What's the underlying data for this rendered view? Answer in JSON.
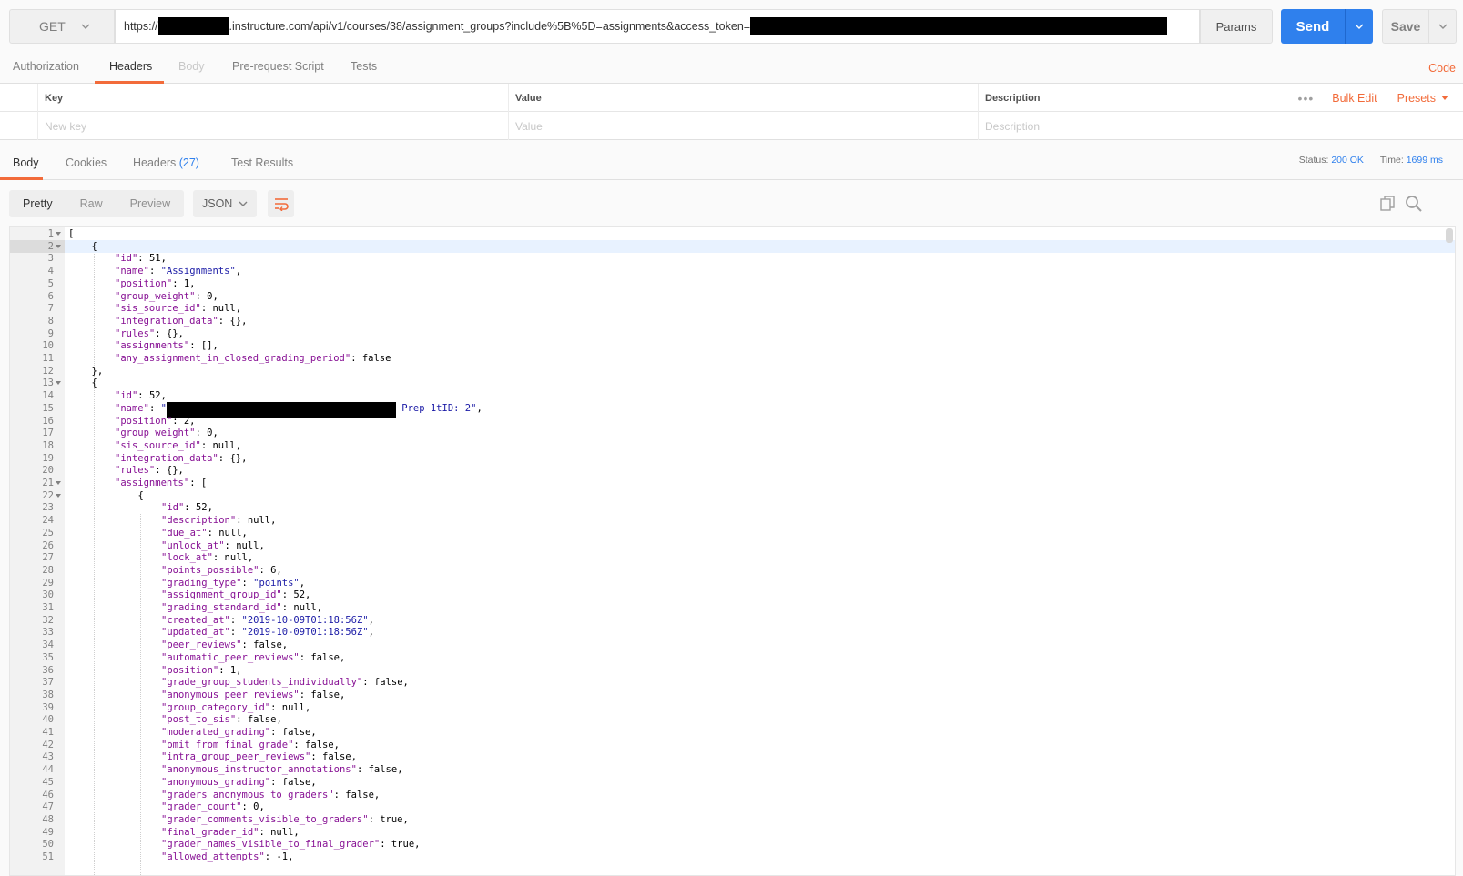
{
  "request": {
    "method": "GET",
    "url_prefix": "https://",
    "url_middle": ".instructure.com/api/v1/courses/38/assignment_groups?include%5B%5D=assignments&access_token=",
    "params_label": "Params",
    "send_label": "Send",
    "save_label": "Save"
  },
  "request_tabs": {
    "authorization": "Authorization",
    "headers": "Headers",
    "body": "Body",
    "prerequest": "Pre-request Script",
    "tests": "Tests",
    "code": "Code"
  },
  "headers_table": {
    "col_key": "Key",
    "col_value": "Value",
    "col_description": "Description",
    "bulk_edit": "Bulk Edit",
    "presets": "Presets",
    "placeholder_key": "New key",
    "placeholder_value": "Value",
    "placeholder_description": "Description"
  },
  "response_tabs": {
    "body": "Body",
    "cookies": "Cookies",
    "headers": "Headers",
    "headers_count": "(27)",
    "test_results": "Test Results",
    "status_label": "Status:",
    "status_value": "200 OK",
    "time_label": "Time:",
    "time_value": "1699 ms"
  },
  "response_toolbar": {
    "pretty": "Pretty",
    "raw": "Raw",
    "preview": "Preview",
    "format": "JSON"
  },
  "colors": {
    "accent": "#f26b3a",
    "send_blue": "#2f80ed",
    "key_purple": "#871094",
    "string_blue": "#1a1aa6"
  },
  "code_lines": [
    {
      "n": "1",
      "fold": true,
      "indent": 0,
      "tokens": [
        [
          "p",
          "["
        ]
      ]
    },
    {
      "n": "2",
      "fold": true,
      "indent": 1,
      "tokens": [
        [
          "p",
          "{"
        ]
      ],
      "active": true
    },
    {
      "n": "3",
      "indent": 2,
      "tokens": [
        [
          "k",
          "\"id\""
        ],
        [
          "p",
          ": 51,"
        ]
      ]
    },
    {
      "n": "4",
      "indent": 2,
      "tokens": [
        [
          "k",
          "\"name\""
        ],
        [
          "p",
          ": "
        ],
        [
          "s",
          "\"Assignments\""
        ],
        [
          "p",
          ","
        ]
      ]
    },
    {
      "n": "5",
      "indent": 2,
      "tokens": [
        [
          "k",
          "\"position\""
        ],
        [
          "p",
          ": 1,"
        ]
      ]
    },
    {
      "n": "6",
      "indent": 2,
      "tokens": [
        [
          "k",
          "\"group_weight\""
        ],
        [
          "p",
          ": 0,"
        ]
      ]
    },
    {
      "n": "7",
      "indent": 2,
      "tokens": [
        [
          "k",
          "\"sis_source_id\""
        ],
        [
          "p",
          ": null,"
        ]
      ]
    },
    {
      "n": "8",
      "indent": 2,
      "tokens": [
        [
          "k",
          "\"integration_data\""
        ],
        [
          "p",
          ": {},"
        ]
      ]
    },
    {
      "n": "9",
      "indent": 2,
      "tokens": [
        [
          "k",
          "\"rules\""
        ],
        [
          "p",
          ": {},"
        ]
      ]
    },
    {
      "n": "10",
      "indent": 2,
      "tokens": [
        [
          "k",
          "\"assignments\""
        ],
        [
          "p",
          ": [],"
        ]
      ]
    },
    {
      "n": "11",
      "indent": 2,
      "tokens": [
        [
          "k",
          "\"any_assignment_in_closed_grading_period\""
        ],
        [
          "p",
          ": false"
        ]
      ]
    },
    {
      "n": "12",
      "indent": 1,
      "tokens": [
        [
          "p",
          "},"
        ]
      ]
    },
    {
      "n": "13",
      "fold": true,
      "indent": 1,
      "tokens": [
        [
          "p",
          "{"
        ]
      ]
    },
    {
      "n": "14",
      "indent": 2,
      "tokens": [
        [
          "k",
          "\"id\""
        ],
        [
          "p",
          ": 52,"
        ]
      ]
    },
    {
      "n": "15",
      "indent": 2,
      "tokens": [
        [
          "k",
          "\"name\""
        ],
        [
          "p",
          ": "
        ],
        [
          "s",
          "\""
        ],
        [
          "r",
          ""
        ],
        [
          "s",
          " Prep 1tID: 2\""
        ],
        [
          "p",
          ","
        ]
      ]
    },
    {
      "n": "16",
      "indent": 2,
      "tokens": [
        [
          "k",
          "\"position\""
        ],
        [
          "p",
          ": 2,"
        ]
      ]
    },
    {
      "n": "17",
      "indent": 2,
      "tokens": [
        [
          "k",
          "\"group_weight\""
        ],
        [
          "p",
          ": 0,"
        ]
      ]
    },
    {
      "n": "18",
      "indent": 2,
      "tokens": [
        [
          "k",
          "\"sis_source_id\""
        ],
        [
          "p",
          ": null,"
        ]
      ]
    },
    {
      "n": "19",
      "indent": 2,
      "tokens": [
        [
          "k",
          "\"integration_data\""
        ],
        [
          "p",
          ": {},"
        ]
      ]
    },
    {
      "n": "20",
      "indent": 2,
      "tokens": [
        [
          "k",
          "\"rules\""
        ],
        [
          "p",
          ": {},"
        ]
      ]
    },
    {
      "n": "21",
      "fold": true,
      "indent": 2,
      "tokens": [
        [
          "k",
          "\"assignments\""
        ],
        [
          "p",
          ": ["
        ]
      ]
    },
    {
      "n": "22",
      "fold": true,
      "indent": 3,
      "tokens": [
        [
          "p",
          "{"
        ]
      ]
    },
    {
      "n": "23",
      "indent": 4,
      "tokens": [
        [
          "k",
          "\"id\""
        ],
        [
          "p",
          ": 52,"
        ]
      ]
    },
    {
      "n": "24",
      "indent": 4,
      "tokens": [
        [
          "k",
          "\"description\""
        ],
        [
          "p",
          ": null,"
        ]
      ]
    },
    {
      "n": "25",
      "indent": 4,
      "tokens": [
        [
          "k",
          "\"due_at\""
        ],
        [
          "p",
          ": null,"
        ]
      ]
    },
    {
      "n": "26",
      "indent": 4,
      "tokens": [
        [
          "k",
          "\"unlock_at\""
        ],
        [
          "p",
          ": null,"
        ]
      ]
    },
    {
      "n": "27",
      "indent": 4,
      "tokens": [
        [
          "k",
          "\"lock_at\""
        ],
        [
          "p",
          ": null,"
        ]
      ]
    },
    {
      "n": "28",
      "indent": 4,
      "tokens": [
        [
          "k",
          "\"points_possible\""
        ],
        [
          "p",
          ": 6,"
        ]
      ]
    },
    {
      "n": "29",
      "indent": 4,
      "tokens": [
        [
          "k",
          "\"grading_type\""
        ],
        [
          "p",
          ": "
        ],
        [
          "s",
          "\"points\""
        ],
        [
          "p",
          ","
        ]
      ]
    },
    {
      "n": "30",
      "indent": 4,
      "tokens": [
        [
          "k",
          "\"assignment_group_id\""
        ],
        [
          "p",
          ": 52,"
        ]
      ]
    },
    {
      "n": "31",
      "indent": 4,
      "tokens": [
        [
          "k",
          "\"grading_standard_id\""
        ],
        [
          "p",
          ": null,"
        ]
      ]
    },
    {
      "n": "32",
      "indent": 4,
      "tokens": [
        [
          "k",
          "\"created_at\""
        ],
        [
          "p",
          ": "
        ],
        [
          "s",
          "\"2019-10-09T01:18:56Z\""
        ],
        [
          "p",
          ","
        ]
      ]
    },
    {
      "n": "33",
      "indent": 4,
      "tokens": [
        [
          "k",
          "\"updated_at\""
        ],
        [
          "p",
          ": "
        ],
        [
          "s",
          "\"2019-10-09T01:18:56Z\""
        ],
        [
          "p",
          ","
        ]
      ]
    },
    {
      "n": "34",
      "indent": 4,
      "tokens": [
        [
          "k",
          "\"peer_reviews\""
        ],
        [
          "p",
          ": false,"
        ]
      ]
    },
    {
      "n": "35",
      "indent": 4,
      "tokens": [
        [
          "k",
          "\"automatic_peer_reviews\""
        ],
        [
          "p",
          ": false,"
        ]
      ]
    },
    {
      "n": "36",
      "indent": 4,
      "tokens": [
        [
          "k",
          "\"position\""
        ],
        [
          "p",
          ": 1,"
        ]
      ]
    },
    {
      "n": "37",
      "indent": 4,
      "tokens": [
        [
          "k",
          "\"grade_group_students_individually\""
        ],
        [
          "p",
          ": false,"
        ]
      ]
    },
    {
      "n": "38",
      "indent": 4,
      "tokens": [
        [
          "k",
          "\"anonymous_peer_reviews\""
        ],
        [
          "p",
          ": false,"
        ]
      ]
    },
    {
      "n": "39",
      "indent": 4,
      "tokens": [
        [
          "k",
          "\"group_category_id\""
        ],
        [
          "p",
          ": null,"
        ]
      ]
    },
    {
      "n": "40",
      "indent": 4,
      "tokens": [
        [
          "k",
          "\"post_to_sis\""
        ],
        [
          "p",
          ": false,"
        ]
      ]
    },
    {
      "n": "41",
      "indent": 4,
      "tokens": [
        [
          "k",
          "\"moderated_grading\""
        ],
        [
          "p",
          ": false,"
        ]
      ]
    },
    {
      "n": "42",
      "indent": 4,
      "tokens": [
        [
          "k",
          "\"omit_from_final_grade\""
        ],
        [
          "p",
          ": false,"
        ]
      ]
    },
    {
      "n": "43",
      "indent": 4,
      "tokens": [
        [
          "k",
          "\"intra_group_peer_reviews\""
        ],
        [
          "p",
          ": false,"
        ]
      ]
    },
    {
      "n": "44",
      "indent": 4,
      "tokens": [
        [
          "k",
          "\"anonymous_instructor_annotations\""
        ],
        [
          "p",
          ": false,"
        ]
      ]
    },
    {
      "n": "45",
      "indent": 4,
      "tokens": [
        [
          "k",
          "\"anonymous_grading\""
        ],
        [
          "p",
          ": false,"
        ]
      ]
    },
    {
      "n": "46",
      "indent": 4,
      "tokens": [
        [
          "k",
          "\"graders_anonymous_to_graders\""
        ],
        [
          "p",
          ": false,"
        ]
      ]
    },
    {
      "n": "47",
      "indent": 4,
      "tokens": [
        [
          "k",
          "\"grader_count\""
        ],
        [
          "p",
          ": 0,"
        ]
      ]
    },
    {
      "n": "48",
      "indent": 4,
      "tokens": [
        [
          "k",
          "\"grader_comments_visible_to_graders\""
        ],
        [
          "p",
          ": true,"
        ]
      ]
    },
    {
      "n": "49",
      "indent": 4,
      "tokens": [
        [
          "k",
          "\"final_grader_id\""
        ],
        [
          "p",
          ": null,"
        ]
      ]
    },
    {
      "n": "50",
      "indent": 4,
      "tokens": [
        [
          "k",
          "\"grader_names_visible_to_final_grader\""
        ],
        [
          "p",
          ": true,"
        ]
      ]
    },
    {
      "n": "51",
      "indent": 4,
      "tokens": [
        [
          "k",
          "\"allowed_attempts\""
        ],
        [
          "p",
          ": -1,"
        ]
      ]
    }
  ]
}
